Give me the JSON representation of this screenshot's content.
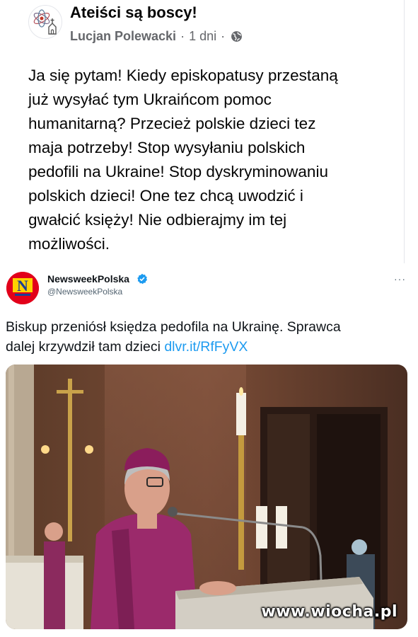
{
  "post": {
    "group_name": "Ateiści są boscy!",
    "author": "Lucjan Polewacki",
    "time": "1 dni",
    "separator": "·",
    "text_lines": [
      "Ja się pytam! Kiedy episkopatusy przestaną",
      "już wysyłać tym Ukraińcom pomoc",
      "humanitarną? Przecież polskie dzieci tez",
      "maja potrzeby! Stop wysyłaniu polskich",
      "pedofili na Ukraine! Stop dyskryminowaniu",
      "polskich dzieci! One tez chcą uwodzić i",
      "gwałcić księży! Nie odbierajmy im tej",
      "możliwości."
    ],
    "icons": {
      "group_avatar": "atom-church-icon",
      "privacy": "globe-icon"
    }
  },
  "tweet": {
    "account_name": "NewsweekPolska",
    "handle": "@NewsweekPolska",
    "text_line_1": "Biskup przeniósł księdza pedofila na Ukrainę. Sprawca",
    "text_line_2_prefix": "dalej krzywdził tam dzieci ",
    "link": "dlvr.it/RfFyVX",
    "more": "···",
    "icons": {
      "logo": "newsweek-logo-icon",
      "verified": "verified-badge-icon"
    },
    "photo": {
      "subject": "bishop-at-lectern-photo"
    }
  },
  "watermark": "www.wiocha.pl",
  "colors": {
    "link": "#1d9bf0",
    "newsweek_red": "#e2001a",
    "bishop_purple": "#9b2a6b",
    "meta_gray": "#65676b"
  }
}
